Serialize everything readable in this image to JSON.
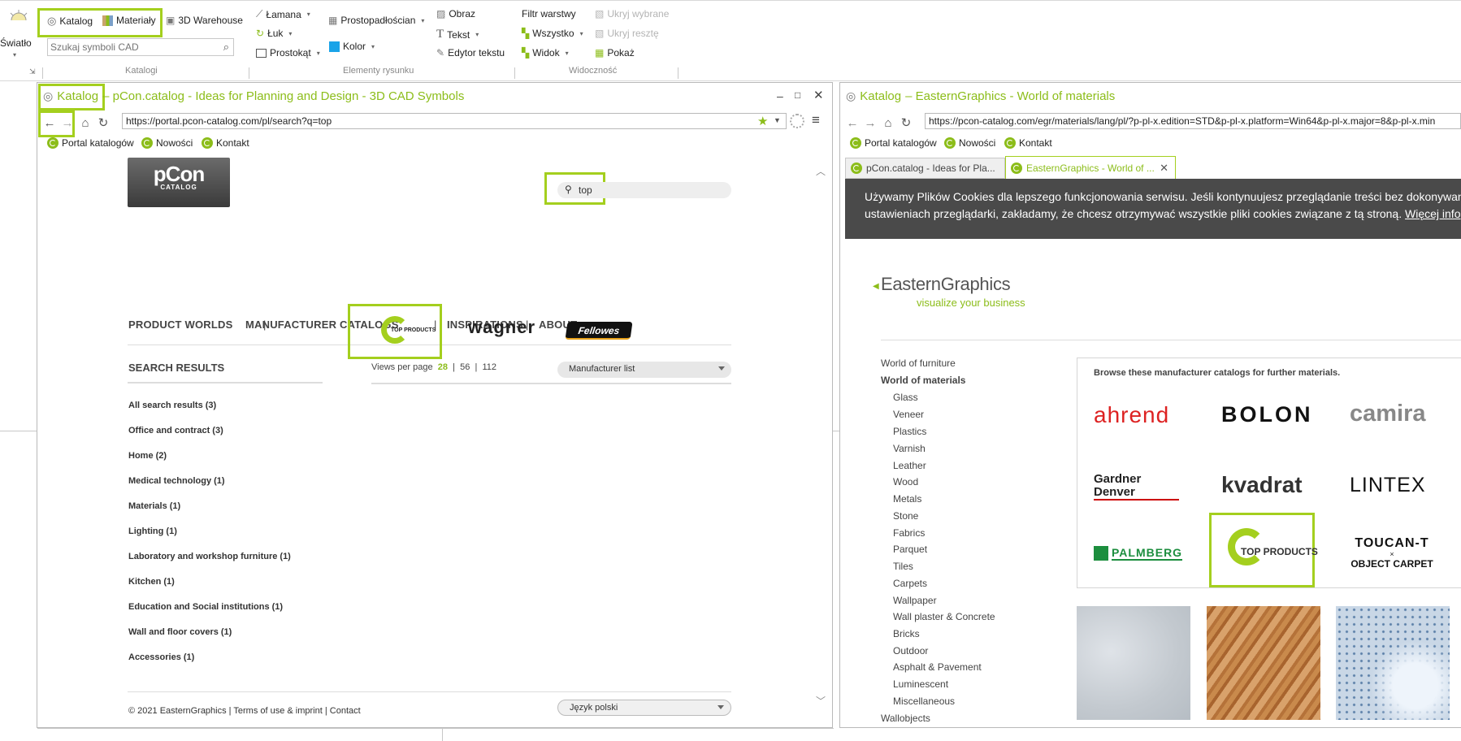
{
  "ribbon": {
    "light": "Światło",
    "katalog": "Katalog",
    "materialy": "Materiały",
    "warehouse": "3D Warehouse",
    "search_placeholder": "Szukaj symboli CAD",
    "lamana": "Łamana",
    "luk": "Łuk",
    "prostokat": "Prostokąt",
    "prostopadloscian": "Prostopadłościan",
    "kolor": "Kolor",
    "obraz": "Obraz",
    "tekst": "Tekst",
    "edytor": "Edytor tekstu",
    "filtr": "Filtr warstwy",
    "wszystko": "Wszystko",
    "widok": "Widok",
    "ukryj_wybrane": "Ukryj wybrane",
    "ukryj_reszte": "Ukryj resztę",
    "pokaz": "Pokaż",
    "group_katalogi": "Katalogi",
    "group_elementy": "Elementy rysunku",
    "group_widocznosc": "Widoczność"
  },
  "left_window": {
    "title_prefix": "Katalog",
    "title_rest": " – pCon.catalog - Ideas for Planning and Design - 3D CAD Symbols",
    "url": "https://portal.pcon-catalog.com/pl/search?q=top",
    "bookmarks": [
      "Portal katalogów",
      "Nowości",
      "Kontakt"
    ],
    "logo_text": "pCon",
    "logo_sub": "CATALOG",
    "search_value": "top",
    "nav": [
      "PRODUCT WORLDS",
      "MANUFACTURER CATALOGS",
      "INSPIRATIONS",
      "ABOUT"
    ],
    "nav_sep": "|",
    "results_heading": "SEARCH RESULTS",
    "views_label": "Views per page",
    "views": [
      "28",
      "56",
      "112"
    ],
    "manufacturer_list": "Manufacturer list",
    "categories": [
      "All search results (3)",
      "Office and contract (3)",
      "Home (2)",
      "Medical technology (1)",
      "Materials (1)",
      "Lighting (1)",
      "Laboratory and workshop furniture (1)",
      "Kitchen (1)",
      "Education and Social institutions (1)",
      "Wall and floor covers (1)",
      "Accessories (1)"
    ],
    "logos": [
      "TOP PRODUCTS",
      "wagner",
      "Fellowes"
    ],
    "footer": "© 2021 EasternGraphics | Terms of use & imprint | Contact",
    "language": "Język polski"
  },
  "right_window": {
    "title_prefix": "Katalog",
    "title_rest": " – EasternGraphics - World of materials",
    "url": "https://pcon-catalog.com/egr/materials/lang/pl/?p-pl-x.edition=STD&p-pl-x.platform=Win64&p-pl-x.major=8&p-pl-x.min",
    "bookmarks": [
      "Portal katalogów",
      "Nowości",
      "Kontakt"
    ],
    "tabs": [
      "pCon.catalog - Ideas for Pla...",
      "EasternGraphics - World of ..."
    ],
    "cookie_line1": "Używamy Plików Cookies dla lepszego funkcjonowania serwisu. Jeśli kontynuujesz przeglądanie treści bez dokonywan",
    "cookie_line2": "ustawieniach przeglądarki, zakładamy, że chcesz otrzymywać wszystkie pliki cookies związane z tą stroną.",
    "cookie_link": "Więcej info",
    "brand": "EasternGraphics",
    "tagline": "visualize your business",
    "nav_top": [
      "World of furniture",
      "World of materials"
    ],
    "materials": [
      "Glass",
      "Veneer",
      "Plastics",
      "Varnish",
      "Leather",
      "Wood",
      "Metals",
      "Stone",
      "Fabrics",
      "Parquet",
      "Tiles",
      "Carpets",
      "Wallpaper",
      "Wall plaster & Concrete",
      "Bricks",
      "Outdoor",
      "Asphalt & Pavement",
      "Luminescent",
      "Miscellaneous"
    ],
    "nav_bottom": "Wallobjects",
    "browse_heading": "Browse these manufacturer catalogs for further materials.",
    "brands": [
      "ahrend",
      "BOLON",
      "camira",
      "Gardner Denver",
      "kvadrat",
      "LINTEX",
      "PALMBERG",
      "TOP PRODUCTS",
      "TOUCAN-T",
      "×",
      "OBJECT CARPET"
    ]
  }
}
